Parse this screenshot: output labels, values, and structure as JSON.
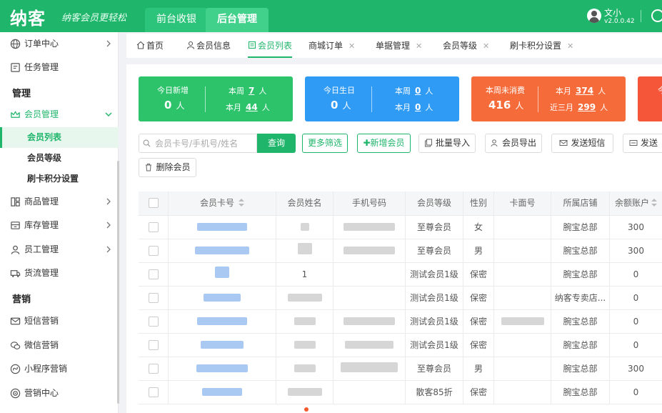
{
  "brand": {
    "logo": "纳客",
    "slogan": "纳客会员更轻松"
  },
  "top_tabs": [
    {
      "label": "前台收银"
    },
    {
      "label": "后台管理"
    }
  ],
  "user": {
    "name": "文小",
    "version": "v2.0.0.42"
  },
  "sidebar": {
    "items": [
      {
        "label": "订单中心",
        "icon": "globe-icon"
      },
      {
        "label": "任务管理",
        "icon": "task-icon"
      },
      {
        "label": "会员管理",
        "icon": "crown-icon"
      },
      {
        "label": "商品管理",
        "icon": "product-icon"
      },
      {
        "label": "库存管理",
        "icon": "inventory-icon"
      },
      {
        "label": "员工管理",
        "icon": "user-icon"
      },
      {
        "label": "货流管理",
        "icon": "truck-icon"
      },
      {
        "label": "短信营销",
        "icon": "mail-icon"
      },
      {
        "label": "微信营销",
        "icon": "wechat-icon"
      },
      {
        "label": "小程序营销",
        "icon": "miniprogram-icon"
      },
      {
        "label": "营销中心",
        "icon": "target-icon"
      }
    ],
    "sections": [
      "管理",
      "营销"
    ],
    "sub_items": [
      "会员列表",
      "会员等级",
      "刷卡积分设置"
    ]
  },
  "tabs": [
    {
      "label": "首页",
      "icon": "home-icon"
    },
    {
      "label": "会员信息",
      "icon": "person-icon"
    },
    {
      "label": "会员列表",
      "icon": "list-icon"
    },
    {
      "label": "商城订单"
    },
    {
      "label": "单据管理"
    },
    {
      "label": "会员等级"
    },
    {
      "label": "刷卡积分设置"
    }
  ],
  "stats": [
    {
      "title": "今日新增",
      "big": "0",
      "unit": "人",
      "line1_label": "本周",
      "line1_value": "7",
      "line2_label": "本月",
      "line2_value": "44",
      "suffix": "人",
      "color": "#2cc36b"
    },
    {
      "title": "今日生日",
      "big": "0",
      "unit": "人",
      "line1_label": "本周",
      "line1_value": "0",
      "line2_label": "本月",
      "line2_value": "0",
      "suffix": "人",
      "color": "#2f9bf5"
    },
    {
      "title": "本周未消费",
      "big": "416",
      "unit": "人",
      "line1_label": "本月",
      "line1_value": "374",
      "line2_label": "近三月",
      "line2_value": "299",
      "suffix": "人",
      "color": "#f66b3a"
    },
    {
      "title": "今",
      "color": "#f5563a"
    }
  ],
  "search": {
    "placeholder": "会员卡号/手机号/姓名",
    "query_label": "查询"
  },
  "toolbar": {
    "more_filter": "更多筛选",
    "add_member": "✚新增会员",
    "batch_import": "批量导入",
    "export": "会员导出",
    "send_sms": "发送短信",
    "send_more": "发送",
    "delete": "删除会员"
  },
  "table": {
    "columns": [
      "会员卡号",
      "会员姓名",
      "手机号码",
      "会员等级",
      "性别",
      "卡面号",
      "所属店铺",
      "余额账户"
    ],
    "rows": [
      {
        "name": "",
        "level": "至尊会员",
        "gender": "女",
        "store": "腕宝总部",
        "balance": "300"
      },
      {
        "name": "",
        "level": "至尊会员",
        "gender": "男",
        "store": "腕宝总部",
        "balance": "300"
      },
      {
        "name": "1",
        "level": "测试会员1级",
        "gender": "保密",
        "store": "腕宝总部",
        "balance": "0"
      },
      {
        "name": "",
        "level": "测试会员1级",
        "gender": "保密",
        "store": "纳客专卖店...",
        "balance": "0"
      },
      {
        "name": "",
        "level": "测试会员1级",
        "gender": "保密",
        "store": "腕宝总部",
        "balance": "0"
      },
      {
        "name": "",
        "level": "测试会员1级",
        "gender": "保密",
        "store": "腕宝总部",
        "balance": "0"
      },
      {
        "name": "",
        "level": "至尊会员",
        "gender": "男",
        "store": "腕宝总部",
        "balance": "300"
      },
      {
        "name": "",
        "level": "散客85折",
        "gender": "保密",
        "store": "腕宝总部",
        "balance": "0"
      }
    ]
  }
}
